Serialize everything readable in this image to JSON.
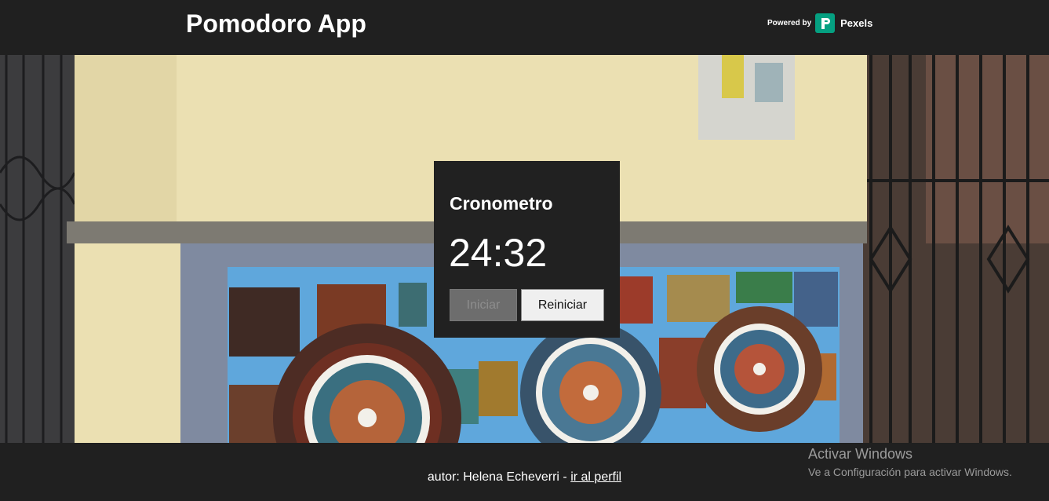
{
  "header": {
    "title": "Pomodoro App",
    "powered_by": "Powered by",
    "brand_name": "Pexels",
    "brand_icon": "pexels-logo-icon",
    "brand_color": "#05a081"
  },
  "timer": {
    "title": "Cronometro",
    "time": "24:32",
    "start_label": "Iniciar",
    "reset_label": "Reiniciar"
  },
  "footer": {
    "author_text": "autor: Helena Echeverri - ",
    "profile_link": "ir al perfil"
  },
  "windows_watermark": {
    "title": "Activar Windows",
    "subtitle": "Ve a Configuración para activar Windows."
  },
  "colors": {
    "background": "#202020",
    "card": "#212121"
  }
}
